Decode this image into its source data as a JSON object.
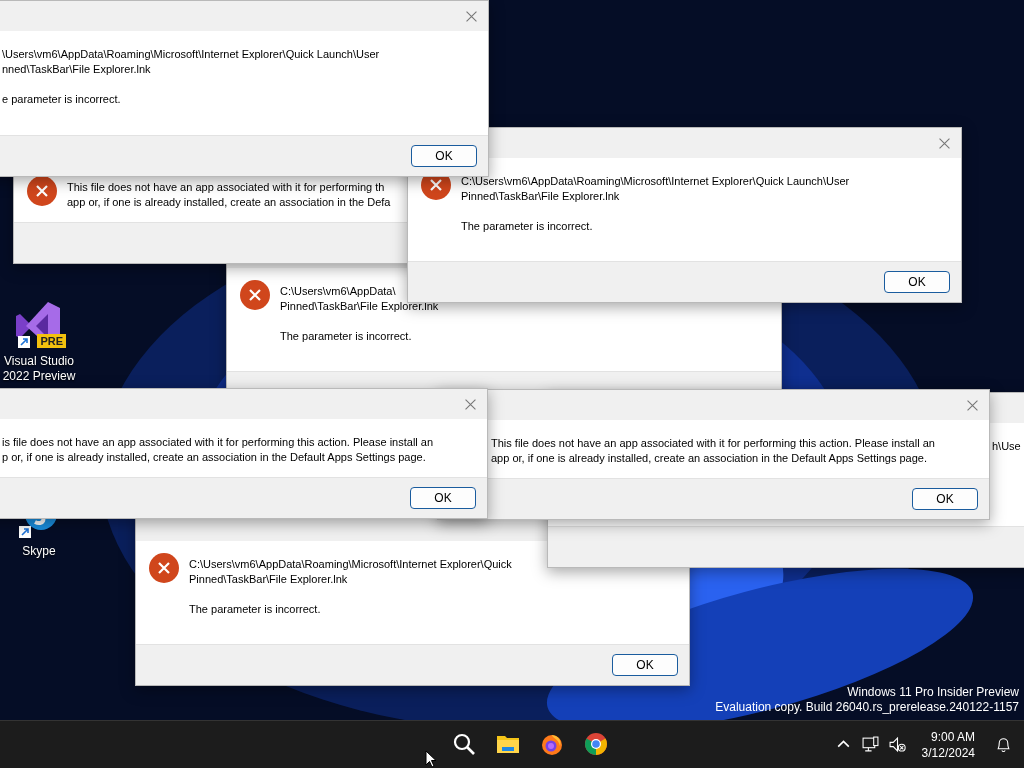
{
  "desktop_icons": [
    {
      "kind": "visual-studio",
      "badge": "PRE",
      "label": "Visual Studio 2022 Preview"
    },
    {
      "kind": "skype",
      "label": "Skype"
    }
  ],
  "dialogs": [
    {
      "lines": [
        "\\Users\\vm6\\AppData\\Roaming\\Microsoft\\Internet Explorer\\Quick Launch\\User",
        "nned\\TaskBar\\File Explorer.lnk"
      ],
      "detail": "e parameter is incorrect.",
      "ok_button": "OK"
    },
    {
      "lines": [
        "This file does not have an app associated with it for performing th",
        "app or, if one is already installed, create an association in the Defa"
      ]
    },
    {
      "lines": [
        "C:\\Users\\vm6\\AppData\\Roaming\\Microsoft\\Internet Explorer\\Quick Launch\\User",
        "Pinned\\TaskBar\\File Explorer.lnk"
      ],
      "detail": "The parameter is incorrect.",
      "ok_button": "OK"
    },
    {
      "lines": [
        "C:\\Users\\vm6\\AppData\\",
        "Pinned\\TaskBar\\File Explorer.lnk"
      ],
      "detail": "The parameter is incorrect."
    },
    {
      "lines": [
        "is file does not have an app associated with it for performing this action. Please install an",
        "p or, if one is already installed, create an association in the Default Apps Settings page."
      ],
      "ok_button": "OK"
    },
    {
      "lines": [
        "This file does not have an app associated with it for performing this action. Please install an",
        "app or, if one is already installed, create an association in the Default Apps Settings page."
      ],
      "ok_button": "OK"
    },
    {
      "lines": [
        "h\\Use"
      ]
    },
    {
      "lines": [
        "C:\\Users\\vm6\\AppData\\Roaming\\Microsoft\\Internet Explorer\\Quick",
        "Pinned\\TaskBar\\File Explorer.lnk"
      ],
      "detail": "The parameter is incorrect.",
      "ok_button": "OK"
    }
  ],
  "watermark": [
    "Windows 11 Pro Insider Preview",
    "Evaluation copy. Build 26040.rs_prerelease.240122-1157"
  ],
  "taskbar": {
    "apps": [
      {
        "kind": "search"
      },
      {
        "kind": "file-explorer"
      },
      {
        "kind": "firefox"
      },
      {
        "kind": "chrome"
      }
    ],
    "tray": [
      {
        "kind": "chevron"
      },
      {
        "kind": "network"
      },
      {
        "kind": "sound-muted"
      }
    ],
    "time": "9:00 AM",
    "date": "3/12/2024"
  }
}
